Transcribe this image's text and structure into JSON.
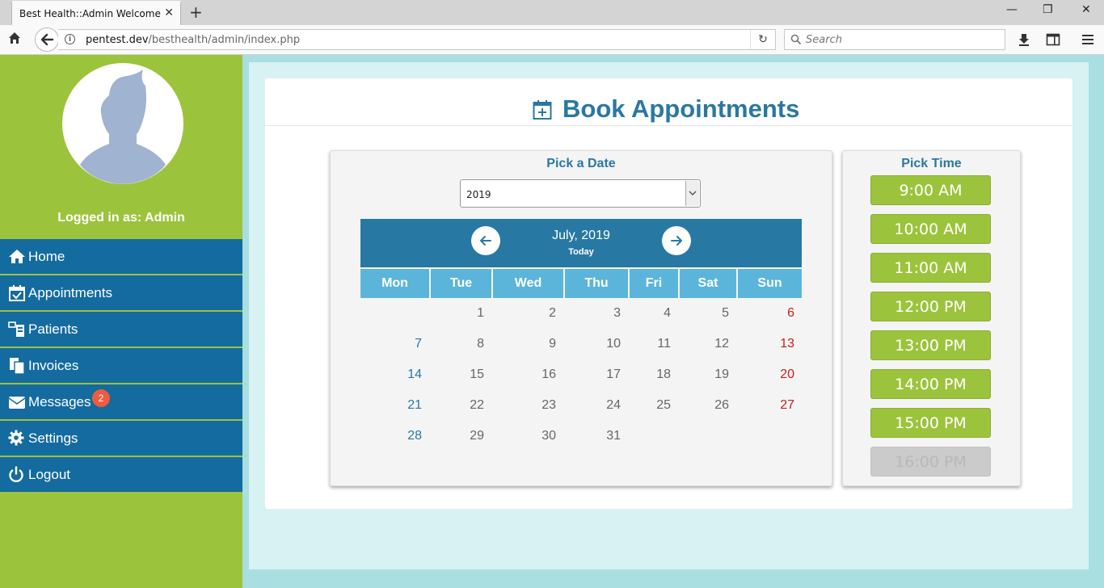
{
  "browser": {
    "tab_title": "Best Health::Admin Welcome",
    "url_host": "pentest.dev",
    "url_path": "/besthealth/admin/index.php",
    "search_placeholder": "Search"
  },
  "sidebar": {
    "logged_in_text": "Logged in as: Admin",
    "items": [
      {
        "label": "Home",
        "icon": "home-icon"
      },
      {
        "label": "Appointments",
        "icon": "calendar-check-icon"
      },
      {
        "label": "Patients",
        "icon": "patients-icon"
      },
      {
        "label": "Invoices",
        "icon": "invoices-icon"
      },
      {
        "label": "Messages",
        "icon": "envelope-icon",
        "badge": "2"
      },
      {
        "label": "Settings",
        "icon": "gear-icon"
      },
      {
        "label": "Logout",
        "icon": "power-icon"
      }
    ]
  },
  "main": {
    "title": "Book Appointments",
    "date_panel": {
      "title": "Pick a Date",
      "year": "2019",
      "month_label": "July, 2019",
      "today_label": "Today",
      "weekdays": [
        "Mon",
        "Tue",
        "Wed",
        "Thu",
        "Fri",
        "Sat",
        "Sun"
      ],
      "weeks": [
        [
          "",
          "1",
          "2",
          "3",
          "4",
          "5",
          "6"
        ],
        [
          "7",
          "8",
          "9",
          "10",
          "11",
          "12",
          "13"
        ],
        [
          "14",
          "15",
          "16",
          "17",
          "18",
          "19",
          "20"
        ],
        [
          "21",
          "22",
          "23",
          "24",
          "25",
          "26",
          "27"
        ],
        [
          "28",
          "29",
          "30",
          "31",
          "",
          "",
          ""
        ]
      ]
    },
    "time_panel": {
      "title": "Pick Time",
      "slots": [
        {
          "label": "9:00 AM",
          "available": true
        },
        {
          "label": "10:00 AM",
          "available": true
        },
        {
          "label": "11:00 AM",
          "available": true
        },
        {
          "label": "12:00 PM",
          "available": true
        },
        {
          "label": "13:00 PM",
          "available": true
        },
        {
          "label": "14:00 PM",
          "available": true
        },
        {
          "label": "15:00 PM",
          "available": true
        },
        {
          "label": "16:00 PM",
          "available": false
        }
      ]
    }
  },
  "colors": {
    "sidebar_green": "#9cc33c",
    "menu_blue": "#146b9f",
    "accent_blue": "#2878a4",
    "weekday_header": "#5bb5db",
    "sunday_red": "#c51d1d",
    "badge_red": "#ef5b3c"
  }
}
